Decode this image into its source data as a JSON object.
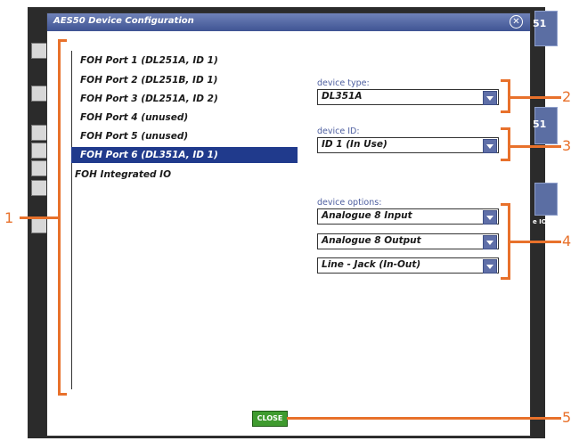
{
  "dialog": {
    "title": "AES50 Device Configuration",
    "close_symbol": "✕"
  },
  "ports": [
    {
      "label": "FOH Port 1 (DL251A, ID 1)",
      "selected": false
    },
    {
      "label": "FOH Port 2 (DL251B, ID 1)",
      "selected": false
    },
    {
      "label": "FOH Port 3 (DL251A, ID 2)",
      "selected": false
    },
    {
      "label": "FOH Port 4 (unused)",
      "selected": false
    },
    {
      "label": "FOH Port 5 (unused)",
      "selected": false
    },
    {
      "label": "FOH Port 6 (DL351A, ID 1)",
      "selected": true
    },
    {
      "label": "FOH Integrated IO",
      "selected": false
    }
  ],
  "device_type": {
    "label": "device type:",
    "value": "DL351A"
  },
  "device_id": {
    "label": "device ID:",
    "value": "ID 1 (In Use)"
  },
  "device_options": {
    "label": "device options:",
    "values": [
      "Analogue 8 Input",
      "Analogue 8 Output",
      "Line - Jack (In-Out)"
    ]
  },
  "close_button": "CLOSE",
  "callouts": [
    "1",
    "2",
    "3",
    "4",
    "5"
  ],
  "background_fragments": [
    "51",
    "51",
    "e IO"
  ],
  "colors": {
    "accent": "#e8712b",
    "selection": "#203a8c",
    "title_bar": "#4a5e9c",
    "close_button": "#3f9b2f"
  }
}
